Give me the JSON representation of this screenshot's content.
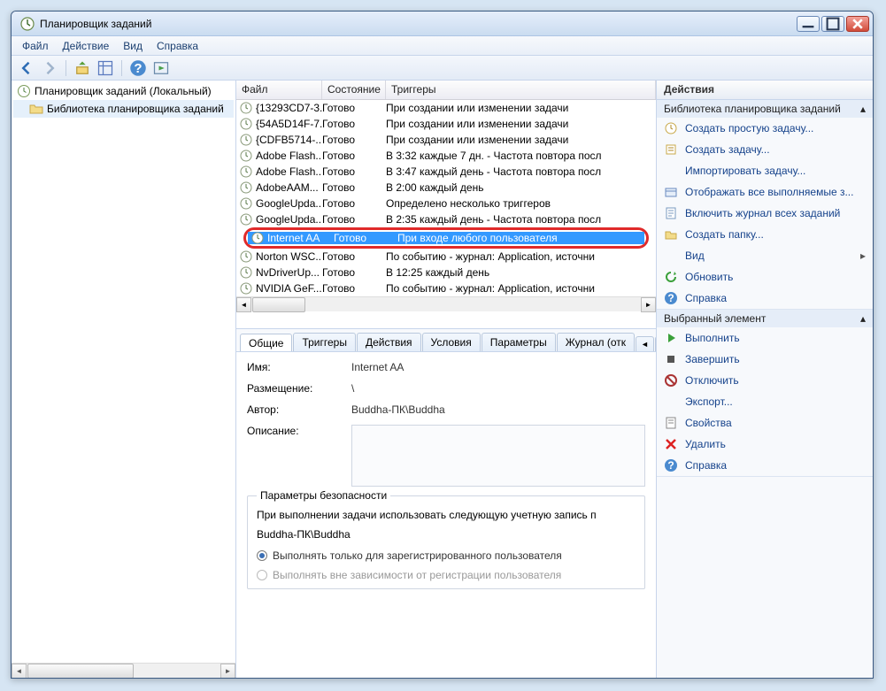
{
  "window": {
    "title": "Планировщик заданий"
  },
  "menu": {
    "file": "Файл",
    "action": "Действие",
    "view": "Вид",
    "help": "Справка"
  },
  "tree": {
    "root": "Планировщик заданий (Локальный)",
    "lib": "Библиотека планировщика заданий"
  },
  "columns": {
    "file": "Файл",
    "state": "Состояние",
    "triggers": "Триггеры"
  },
  "tasks": [
    {
      "name": "{13293CD7-3...",
      "state": "Готово",
      "trigger": "При создании или изменении задачи"
    },
    {
      "name": "{54A5D14F-7...",
      "state": "Готово",
      "trigger": "При создании или изменении задачи"
    },
    {
      "name": "{CDFB5714-...",
      "state": "Готово",
      "trigger": "При создании или изменении задачи"
    },
    {
      "name": "Adobe Flash...",
      "state": "Готово",
      "trigger": "В 3:32 каждые 7 дн. - Частота повтора посл"
    },
    {
      "name": "Adobe Flash...",
      "state": "Готово",
      "trigger": "В 3:47 каждый день - Частота повтора посл"
    },
    {
      "name": "AdobeAAM...",
      "state": "Готово",
      "trigger": "В 2:00 каждый день"
    },
    {
      "name": "GoogleUpda...",
      "state": "Готово",
      "trigger": "Определено несколько триггеров"
    },
    {
      "name": "GoogleUpda...",
      "state": "Готово",
      "trigger": "В 2:35 каждый день - Частота повтора посл"
    },
    {
      "name": "Internet AA",
      "state": "Готово",
      "trigger": "При входе любого пользователя",
      "selected": true
    },
    {
      "name": "Norton WSC...",
      "state": "Готово",
      "trigger": "По событию - журнал: Application, источни"
    },
    {
      "name": "NvDriverUp...",
      "state": "Готово",
      "trigger": "В 12:25 каждый день"
    },
    {
      "name": "NVIDIA GeF...",
      "state": "Готово",
      "trigger": "По событию - журнал: Application, источни"
    }
  ],
  "tabs": {
    "general": "Общие",
    "triggers": "Триггеры",
    "actions": "Действия",
    "conditions": "Условия",
    "params": "Параметры",
    "log": "Журнал (отк"
  },
  "form": {
    "name_label": "Имя:",
    "name_value": "Internet AA",
    "location_label": "Размещение:",
    "location_value": "\\",
    "author_label": "Автор:",
    "author_value": "Buddha-ПК\\Buddha",
    "desc_label": "Описание:",
    "security_legend": "Параметры безопасности",
    "security_text": "При выполнении задачи использовать следующую учетную запись п",
    "security_account": "Buddha-ПК\\Buddha",
    "radio1": "Выполнять только для зарегистрированного пользователя",
    "radio2": "Выполнять вне зависимости от регистрации пользователя"
  },
  "actions_panel": {
    "header": "Действия",
    "section1": "Библиотека планировщика заданий",
    "items1": [
      "Создать простую задачу...",
      "Создать задачу...",
      "Импортировать задачу...",
      "Отображать все выполняемые з...",
      "Включить журнал всех заданий",
      "Создать папку...",
      "Вид",
      "Обновить",
      "Справка"
    ],
    "section2": "Выбранный элемент",
    "items2": [
      "Выполнить",
      "Завершить",
      "Отключить",
      "Экспорт...",
      "Свойства",
      "Удалить",
      "Справка"
    ]
  }
}
